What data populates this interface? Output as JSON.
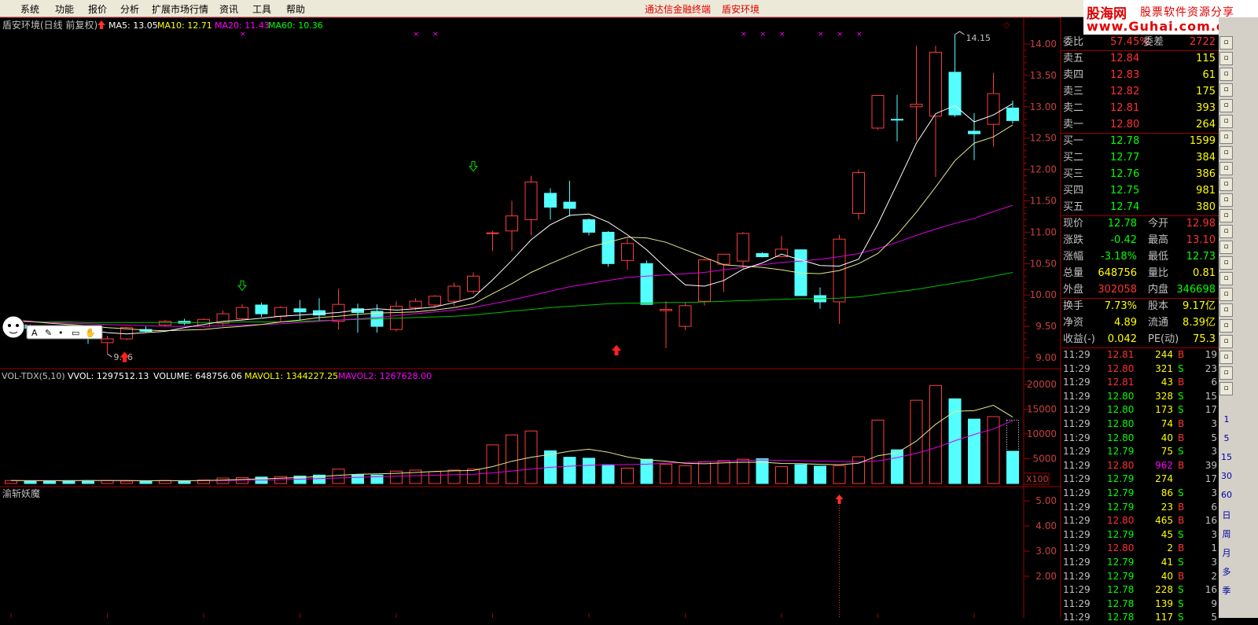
{
  "menu": [
    "系统",
    "功能",
    "报价",
    "分析",
    "扩展市场行情",
    "资讯",
    "工具",
    "帮助"
  ],
  "center_title": [
    "通达信金融终端",
    "盾安环境"
  ],
  "brand": {
    "name": "股海网",
    "slogan": "股票软件资源分享",
    "url": "www.Guhai.com.cn"
  },
  "chart": {
    "stock_title": "盾安环境(日线 前复权)",
    "ma_legend": [
      {
        "label": "MA5: 13.05",
        "color": "#ffffff"
      },
      {
        "label": "MA10: 12.71",
        "color": "#ffff00"
      },
      {
        "label": "MA20: 11.43",
        "color": "#ff00ff"
      },
      {
        "label": "MA60: 10.36",
        "color": "#00ff00"
      }
    ],
    "price_axis": [
      "14.00",
      "13.50",
      "13.00",
      "12.50",
      "12.00",
      "11.50",
      "11.00",
      "10.50",
      "10.00",
      "9.50",
      "9.00"
    ],
    "high_label": "14.15",
    "low_label": "9.06",
    "vol_legend": [
      {
        "label": "VOL-TDX(5,10)",
        "color": "#c0c0c0"
      },
      {
        "label": "VVOL: 1297512.13",
        "color": "#ffffff"
      },
      {
        "label": "VOLUME: 648756.06",
        "color": "#ffffff"
      },
      {
        "label": "MAVOL1: 1344227.25",
        "color": "#ffff00"
      },
      {
        "label": "MAVOL2: 1267628.00",
        "color": "#ff00ff"
      }
    ],
    "vol_axis": [
      "20000",
      "15000",
      "10000",
      "5000"
    ],
    "vol_unit": "X100",
    "indicator_title": "渝斩妖魔",
    "ind_axis": [
      "5.00",
      "4.00",
      "3.00",
      "2.00"
    ]
  },
  "chart_data": {
    "type": "candlestick",
    "price_range": [
      8.9,
      14.35
    ],
    "candles": [
      [
        9.48,
        9.52,
        9.44,
        9.49
      ],
      [
        9.5,
        9.53,
        9.45,
        9.47
      ],
      [
        9.48,
        9.5,
        9.42,
        9.46
      ],
      [
        9.46,
        9.48,
        9.38,
        9.4
      ],
      [
        9.4,
        9.45,
        9.22,
        9.32
      ],
      [
        9.24,
        9.35,
        9.06,
        9.3
      ],
      [
        9.3,
        9.5,
        9.28,
        9.48
      ],
      [
        9.45,
        9.5,
        9.4,
        9.42
      ],
      [
        9.52,
        9.6,
        9.5,
        9.58
      ],
      [
        9.58,
        9.62,
        9.52,
        9.55
      ],
      [
        9.5,
        9.63,
        9.48,
        9.61
      ],
      [
        9.55,
        9.75,
        9.5,
        9.7
      ],
      [
        9.62,
        9.85,
        9.6,
        9.8
      ],
      [
        9.84,
        9.88,
        9.65,
        9.7
      ],
      [
        9.66,
        9.82,
        9.58,
        9.8
      ],
      [
        9.78,
        9.92,
        9.6,
        9.73
      ],
      [
        9.75,
        9.95,
        9.58,
        9.68
      ],
      [
        9.58,
        10.1,
        9.45,
        9.85
      ],
      [
        9.78,
        9.86,
        9.4,
        9.72
      ],
      [
        9.74,
        9.85,
        9.4,
        9.5
      ],
      [
        9.45,
        9.9,
        9.42,
        9.82
      ],
      [
        9.8,
        9.95,
        9.76,
        9.9
      ],
      [
        9.84,
        10.0,
        9.8,
        9.98
      ],
      [
        9.9,
        10.2,
        9.82,
        10.14
      ],
      [
        10.06,
        10.36,
        10.02,
        10.3
      ],
      [
        10.98,
        11.02,
        10.7,
        10.99
      ],
      [
        11.02,
        11.5,
        10.7,
        11.26
      ],
      [
        11.2,
        11.9,
        10.95,
        11.8
      ],
      [
        11.62,
        11.7,
        11.2,
        11.4
      ],
      [
        11.48,
        11.82,
        11.25,
        11.38
      ],
      [
        11.2,
        11.22,
        10.95,
        11.0
      ],
      [
        11.0,
        11.02,
        10.45,
        10.5
      ],
      [
        10.55,
        10.9,
        10.4,
        10.82
      ],
      [
        10.5,
        10.55,
        9.85,
        9.85
      ],
      [
        9.75,
        9.9,
        9.15,
        9.77
      ],
      [
        9.5,
        9.88,
        9.44,
        9.83
      ],
      [
        9.9,
        10.58,
        9.83,
        10.56
      ],
      [
        10.49,
        10.63,
        10.05,
        10.65
      ],
      [
        10.54,
        11.0,
        10.42,
        10.98
      ],
      [
        10.66,
        10.68,
        10.6,
        10.61
      ],
      [
        10.61,
        10.94,
        10.63,
        10.73
      ],
      [
        10.72,
        10.72,
        9.99,
        9.99
      ],
      [
        9.99,
        10.12,
        9.78,
        9.89
      ],
      [
        9.89,
        10.96,
        9.54,
        10.89
      ],
      [
        11.3,
        12.0,
        11.2,
        11.95
      ],
      [
        12.66,
        13.18,
        12.63,
        13.18
      ],
      [
        12.8,
        13.19,
        12.45,
        12.79
      ],
      [
        13.0,
        13.97,
        12.46,
        13.04
      ],
      [
        12.85,
        13.97,
        11.88,
        13.87
      ],
      [
        13.55,
        14.15,
        12.84,
        12.87
      ],
      [
        12.61,
        12.9,
        12.15,
        12.57
      ],
      [
        12.72,
        13.54,
        12.36,
        13.21
      ],
      [
        12.98,
        13.1,
        12.73,
        12.78
      ]
    ],
    "ma5": [
      9.54,
      9.51,
      9.48,
      9.46,
      9.44,
      9.4,
      9.38,
      9.4,
      9.42,
      9.48,
      9.53,
      9.58,
      9.6,
      9.63,
      9.66,
      9.68,
      9.7,
      9.72,
      9.76,
      9.78,
      9.76,
      9.78,
      9.81,
      9.88,
      9.96,
      10.24,
      10.55,
      10.88,
      11.12,
      11.27,
      11.29,
      11.16,
      10.96,
      10.72,
      10.43,
      10.16,
      10.14,
      10.23,
      10.41,
      10.51,
      10.65,
      10.56,
      10.47,
      10.46,
      10.57,
      11.13,
      11.77,
      12.42,
      12.89,
      13.02,
      12.76,
      12.87,
      13.05
    ],
    "ma10": [
      9.6,
      9.58,
      9.55,
      9.53,
      9.51,
      9.48,
      9.46,
      9.44,
      9.43,
      9.44,
      9.45,
      9.48,
      9.5,
      9.53,
      9.57,
      9.6,
      9.64,
      9.66,
      9.69,
      9.71,
      9.72,
      9.73,
      9.76,
      9.8,
      9.86,
      10.02,
      10.18,
      10.36,
      10.5,
      10.63,
      10.76,
      10.84,
      10.92,
      10.91,
      10.84,
      10.72,
      10.6,
      10.48,
      10.46,
      10.44,
      10.4,
      10.35,
      10.34,
      10.39,
      10.5,
      10.66,
      10.96,
      11.32,
      11.72,
      12.14,
      12.42,
      12.52,
      12.71
    ],
    "ma20": [
      9.58,
      9.57,
      9.56,
      9.55,
      9.54,
      9.53,
      9.52,
      9.51,
      9.5,
      9.5,
      9.5,
      9.51,
      9.52,
      9.53,
      9.54,
      9.56,
      9.58,
      9.6,
      9.62,
      9.64,
      9.67,
      9.7,
      9.73,
      9.76,
      9.8,
      9.86,
      9.92,
      9.99,
      10.06,
      10.13,
      10.18,
      10.23,
      10.28,
      10.3,
      10.32,
      10.34,
      10.36,
      10.4,
      10.44,
      10.48,
      10.52,
      10.54,
      10.57,
      10.61,
      10.66,
      10.74,
      10.84,
      10.95,
      11.05,
      11.14,
      11.22,
      11.33,
      11.43
    ],
    "ma60": [
      9.57,
      9.57,
      9.57,
      9.57,
      9.56,
      9.56,
      9.56,
      9.56,
      9.56,
      9.56,
      9.56,
      9.56,
      9.57,
      9.57,
      9.57,
      9.58,
      9.59,
      9.6,
      9.61,
      9.62,
      9.63,
      9.64,
      9.65,
      9.66,
      9.68,
      9.71,
      9.74,
      9.77,
      9.8,
      9.82,
      9.84,
      9.86,
      9.87,
      9.87,
      9.88,
      9.88,
      9.89,
      9.9,
      9.91,
      9.92,
      9.93,
      9.94,
      9.94,
      9.95,
      9.97,
      10.01,
      10.05,
      10.09,
      10.14,
      10.19,
      10.24,
      10.3,
      10.36
    ],
    "volume": [
      600,
      550,
      520,
      580,
      600,
      620,
      500,
      480,
      620,
      540,
      700,
      1100,
      1200,
      1300,
      1400,
      1500,
      1700,
      2900,
      1800,
      1700,
      2500,
      2700,
      2400,
      2700,
      2900,
      7800,
      9800,
      10600,
      6600,
      5300,
      5100,
      3800,
      3100,
      4900,
      3900,
      3600,
      4400,
      4600,
      4900,
      5000,
      3400,
      3800,
      3500,
      3600,
      5400,
      12800,
      6800,
      16800,
      19800,
      17100,
      13000,
      13500,
      6500
    ],
    "mavol1": [
      580,
      570,
      560,
      570,
      590,
      600,
      580,
      560,
      570,
      560,
      600,
      700,
      820,
      940,
      1070,
      1200,
      1400,
      1650,
      1860,
      1940,
      2050,
      2220,
      2450,
      2560,
      2640,
      3420,
      4490,
      5300,
      5880,
      6500,
      6920,
      6320,
      5370,
      4760,
      4500,
      4080,
      3980,
      4160,
      4280,
      4300,
      4050,
      4000,
      3880,
      3800,
      4100,
      5610,
      6210,
      8560,
      11960,
      14580,
      14700,
      15800,
      13400
    ],
    "mavol2": [
      590,
      585,
      580,
      575,
      580,
      585,
      580,
      575,
      580,
      575,
      580,
      610,
      650,
      700,
      780,
      870,
      980,
      1110,
      1240,
      1360,
      1470,
      1570,
      1660,
      1760,
      1860,
      2150,
      2520,
      2920,
      3270,
      3490,
      3660,
      3780,
      3830,
      3910,
      4080,
      4250,
      4340,
      4490,
      4620,
      4760,
      4650,
      4590,
      4530,
      4450,
      4320,
      4570,
      5230,
      6100,
      7220,
      8630,
      9900,
      11000,
      12676
    ]
  },
  "quote": {
    "header": {
      "k1": "委比",
      "v1": "57.45%",
      "k2": "委差",
      "v2": "2722"
    },
    "sells": [
      {
        "label": "卖五",
        "price": "12.84",
        "vol": "115"
      },
      {
        "label": "卖四",
        "price": "12.83",
        "vol": "61"
      },
      {
        "label": "卖三",
        "price": "12.82",
        "vol": "175"
      },
      {
        "label": "卖二",
        "price": "12.81",
        "vol": "393"
      },
      {
        "label": "卖一",
        "price": "12.80",
        "vol": "264"
      }
    ],
    "buys": [
      {
        "label": "买一",
        "price": "12.78",
        "vol": "1599"
      },
      {
        "label": "买二",
        "price": "12.77",
        "vol": "384"
      },
      {
        "label": "买三",
        "price": "12.76",
        "vol": "386"
      },
      {
        "label": "买四",
        "price": "12.75",
        "vol": "981"
      },
      {
        "label": "买五",
        "price": "12.74",
        "vol": "380"
      }
    ],
    "stats": [
      {
        "k1": "现价",
        "v1": "12.78",
        "c1": "#00ff00",
        "k2": "今开",
        "v2": "12.98",
        "c2": "#ff3030"
      },
      {
        "k1": "涨跌",
        "v1": "-0.42",
        "c1": "#00ff00",
        "k2": "最高",
        "v2": "13.10",
        "c2": "#ff3030"
      },
      {
        "k1": "涨幅",
        "v1": "-3.18%",
        "c1": "#00ff00",
        "k2": "最低",
        "v2": "12.73",
        "c2": "#00ff00"
      },
      {
        "k1": "总量",
        "v1": "648756",
        "c1": "#ffff00",
        "k2": "量比",
        "v2": "0.81",
        "c2": "#ffff00"
      },
      {
        "k1": "外盘",
        "v1": "302058",
        "c1": "#ff3030",
        "k2": "内盘",
        "v2": "346698",
        "c2": "#00ff00"
      },
      {
        "k1": "换手",
        "v1": "7.73%",
        "c1": "#ffff00",
        "k2": "股本",
        "v2": "9.17亿",
        "c2": "#ffff00"
      },
      {
        "k1": "净资",
        "v1": "4.89",
        "c1": "#ffff00",
        "k2": "流通",
        "v2": "8.39亿",
        "c2": "#ffff00"
      },
      {
        "k1": "收益(-)",
        "v1": "0.042",
        "c1": "#ffff00",
        "k2": "PE(动)",
        "v2": "75.3",
        "c2": "#ffff00"
      }
    ],
    "ticks": [
      {
        "t": "11:29",
        "p": "12.81",
        "pc": "#ff3030",
        "v": "244",
        "vc": "#ffff00",
        "s": "B",
        "n": "19"
      },
      {
        "t": "11:29",
        "p": "12.80",
        "pc": "#ff3030",
        "v": "321",
        "vc": "#ffff00",
        "s": "S",
        "n": "23"
      },
      {
        "t": "11:29",
        "p": "12.81",
        "pc": "#ff3030",
        "v": "43",
        "vc": "#ffff00",
        "s": "B",
        "n": "6"
      },
      {
        "t": "11:29",
        "p": "12.80",
        "pc": "#00ff00",
        "v": "328",
        "vc": "#ffff00",
        "s": "S",
        "n": "15"
      },
      {
        "t": "11:29",
        "p": "12.80",
        "pc": "#00ff00",
        "v": "173",
        "vc": "#ffff00",
        "s": "S",
        "n": "17"
      },
      {
        "t": "11:29",
        "p": "12.80",
        "pc": "#00ff00",
        "v": "74",
        "vc": "#ffff00",
        "s": "B",
        "n": "3"
      },
      {
        "t": "11:29",
        "p": "12.80",
        "pc": "#00ff00",
        "v": "40",
        "vc": "#ffff00",
        "s": "B",
        "n": "5"
      },
      {
        "t": "11:29",
        "p": "12.79",
        "pc": "#00ff00",
        "v": "75",
        "vc": "#ffff00",
        "s": "S",
        "n": "3"
      },
      {
        "t": "11:29",
        "p": "12.80",
        "pc": "#ff3030",
        "v": "962",
        "vc": "#ff00ff",
        "s": "B",
        "n": "39"
      },
      {
        "t": "11:29",
        "p": "12.79",
        "pc": "#00ff00",
        "v": "274",
        "vc": "#ffff00",
        "s": "",
        "n": "17"
      },
      {
        "t": "11:29",
        "p": "12.79",
        "pc": "#00ff00",
        "v": "86",
        "vc": "#ffff00",
        "s": "S",
        "n": "3"
      },
      {
        "t": "11:29",
        "p": "12.79",
        "pc": "#00ff00",
        "v": "23",
        "vc": "#ffff00",
        "s": "B",
        "n": "6"
      },
      {
        "t": "11:29",
        "p": "12.80",
        "pc": "#ff3030",
        "v": "465",
        "vc": "#ffff00",
        "s": "B",
        "n": "16"
      },
      {
        "t": "11:29",
        "p": "12.79",
        "pc": "#00ff00",
        "v": "45",
        "vc": "#ffff00",
        "s": "S",
        "n": "3"
      },
      {
        "t": "11:29",
        "p": "12.80",
        "pc": "#ff3030",
        "v": "2",
        "vc": "#ffff00",
        "s": "B",
        "n": "1"
      },
      {
        "t": "11:29",
        "p": "12.79",
        "pc": "#00ff00",
        "v": "41",
        "vc": "#ffff00",
        "s": "S",
        "n": "3"
      },
      {
        "t": "11:29",
        "p": "12.79",
        "pc": "#00ff00",
        "v": "40",
        "vc": "#ffff00",
        "s": "B",
        "n": "2"
      },
      {
        "t": "11:29",
        "p": "12.78",
        "pc": "#00ff00",
        "v": "228",
        "vc": "#ffff00",
        "s": "S",
        "n": "16"
      },
      {
        "t": "11:29",
        "p": "12.78",
        "pc": "#00ff00",
        "v": "139",
        "vc": "#ffff00",
        "s": "S",
        "n": "9"
      },
      {
        "t": "11:29",
        "p": "12.78",
        "pc": "#00ff00",
        "v": "117",
        "vc": "#ffff00",
        "s": "S",
        "n": "5"
      }
    ]
  },
  "toolbar_right": {
    "labels": [
      "1",
      "5",
      "15",
      "30",
      "60",
      "日",
      "周",
      "月",
      "多",
      "季"
    ]
  }
}
